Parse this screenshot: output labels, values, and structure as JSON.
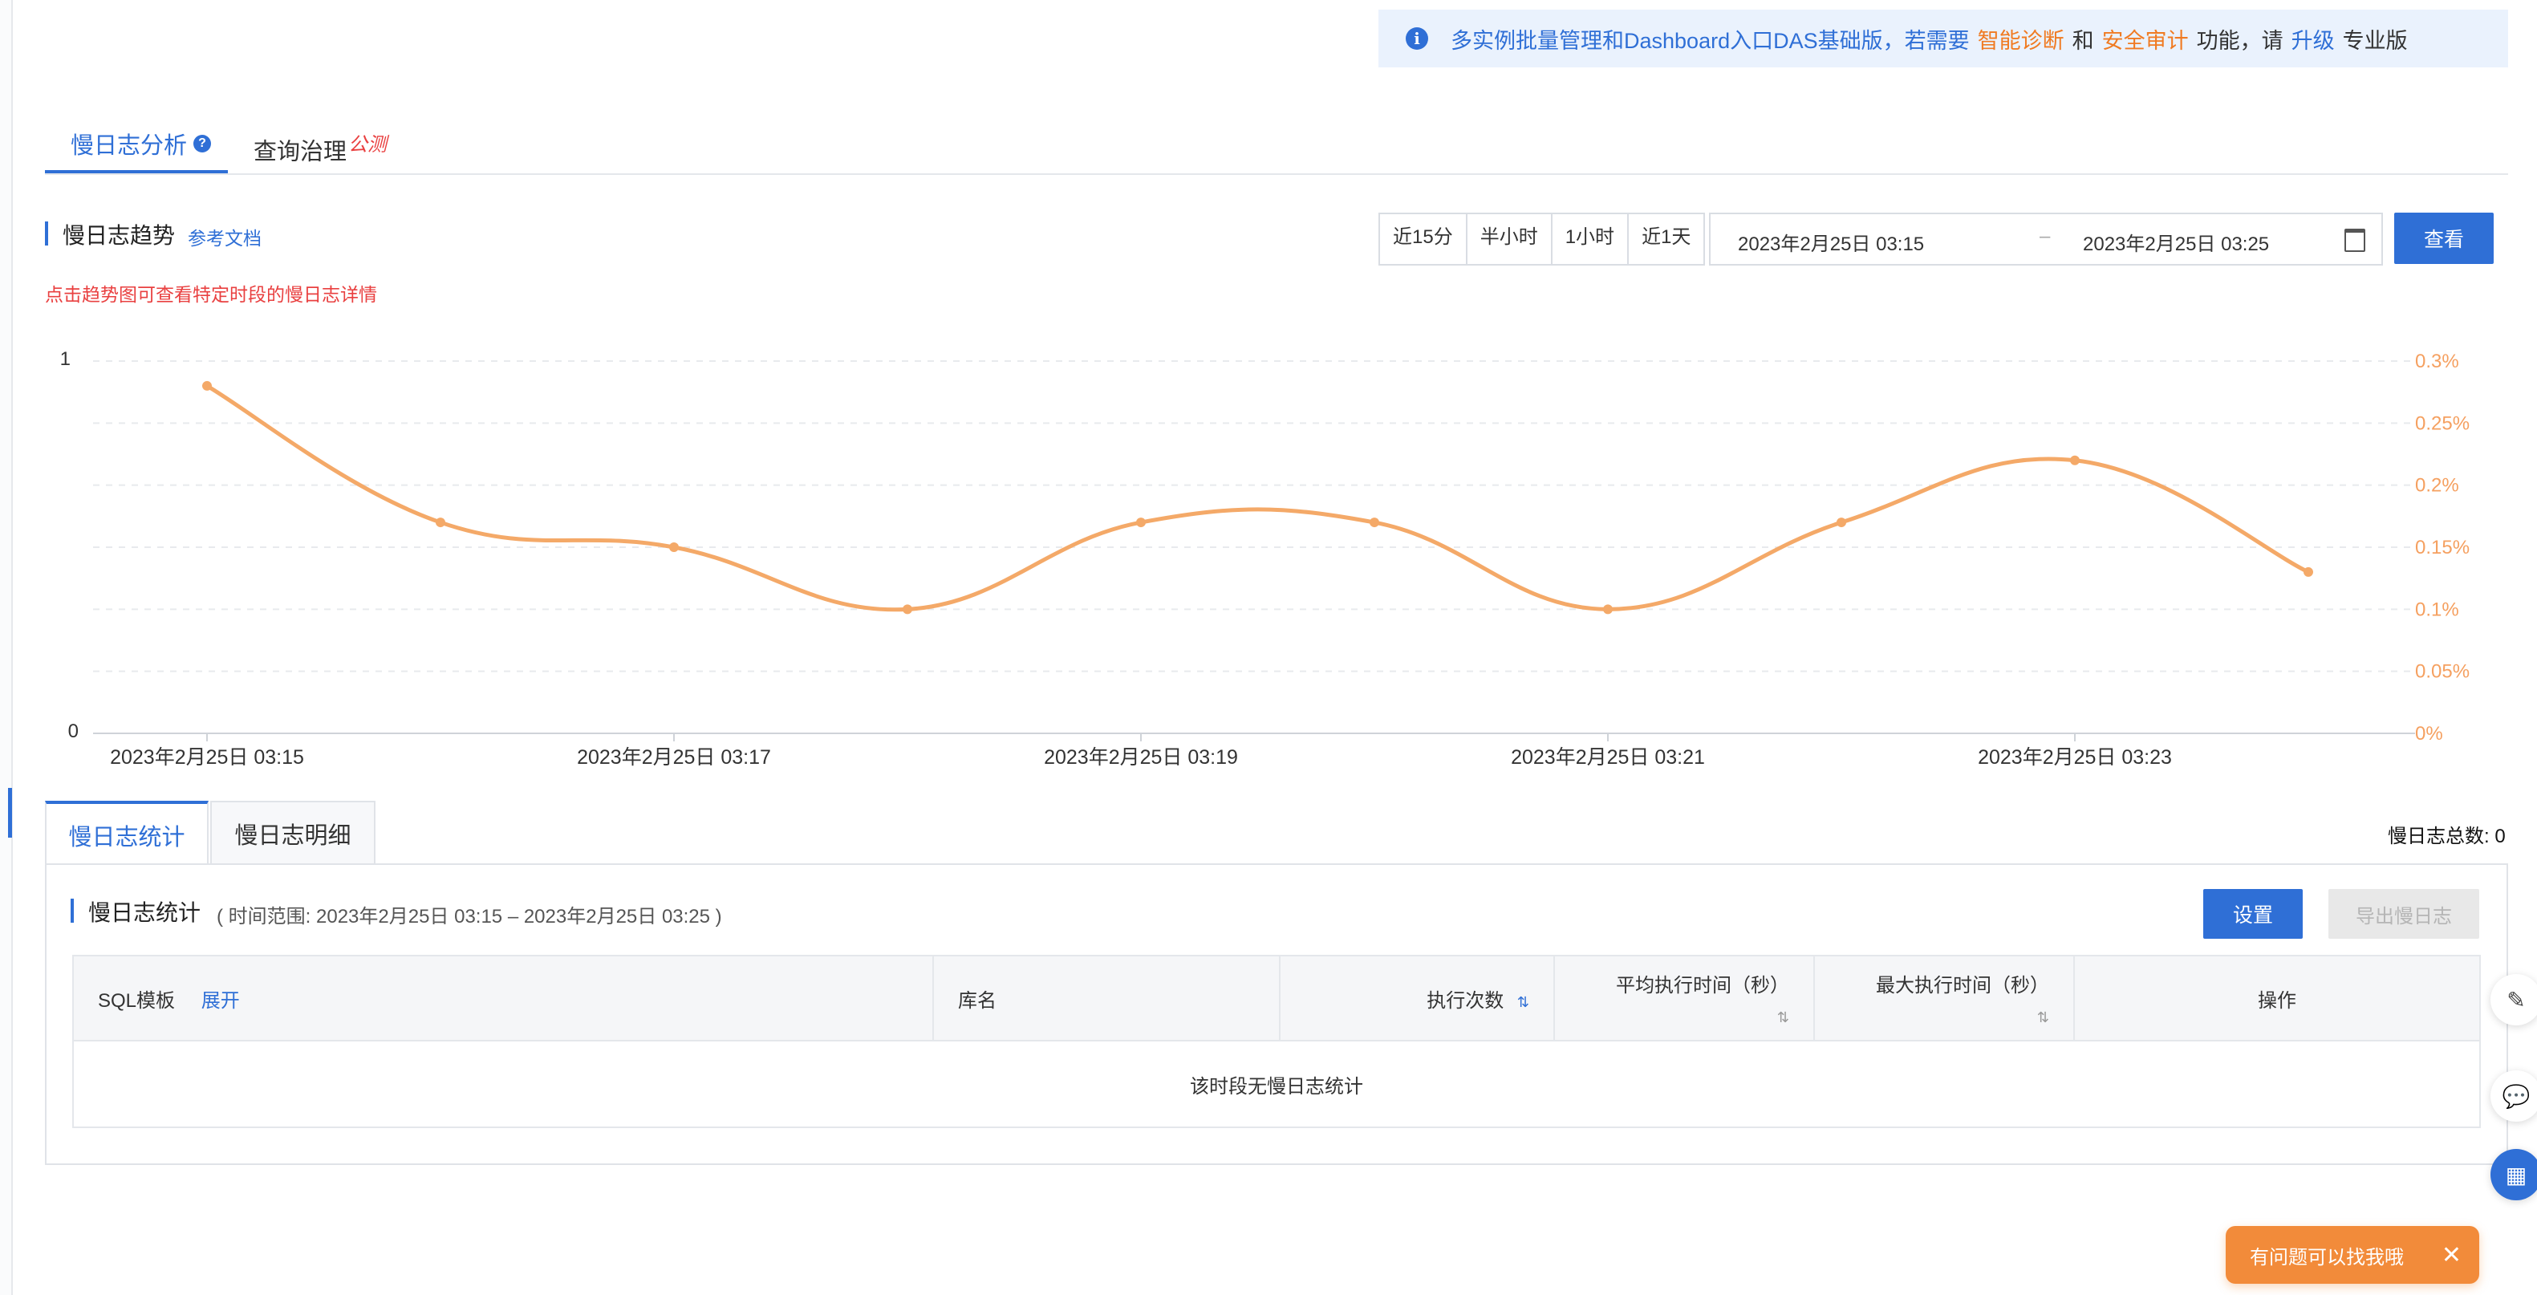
{
  "notice": {
    "prefix": "多实例批量管理和Dashboard入口DAS基础版，若需要",
    "link1": "智能诊断",
    "and": "和",
    "link2": "安全审计",
    "mid": "功能，请",
    "upgrade": "升级",
    "suffix": "专业版"
  },
  "tabs": {
    "slow_log_analysis": "慢日志分析",
    "query_governance": "查询治理",
    "public_beta": "公测"
  },
  "trend": {
    "title": "慢日志趋势",
    "doc_link": "参考文档",
    "hint": "点击趋势图可查看特定时段的慢日志详情"
  },
  "time_filter": {
    "quick": [
      "近15分",
      "半小时",
      "1小时",
      "近1天"
    ],
    "start": "2023年2月25日 03:15",
    "separator": "–",
    "end": "2023年2月25日 03:25",
    "query_button": "查看"
  },
  "chart_data": {
    "type": "line",
    "x_ticks": [
      "2023年2月25日 03:15",
      "2023年2月25日 03:17",
      "2023年2月25日 03:19",
      "2023年2月25日 03:21",
      "2023年2月25日 03:23"
    ],
    "x_minutes": [
      0,
      1,
      2,
      3,
      4,
      5,
      6,
      7,
      8,
      9
    ],
    "values": [
      0.28,
      0.17,
      0.15,
      0.1,
      0.17,
      0.17,
      0.1,
      0.17,
      0.22,
      0.13
    ],
    "left_axis_ticks": [
      "1",
      "0"
    ],
    "right_axis_ticks": [
      "0.3%",
      "0.25%",
      "0.2%",
      "0.15%",
      "0.1%",
      "0.05%",
      "0%"
    ],
    "ylim": [
      0,
      0.3
    ],
    "line_color": "#f4a968",
    "grid": "dashed-horizontal"
  },
  "lower_tabs": {
    "stats": "慢日志统计",
    "detail": "慢日志明细"
  },
  "total": "慢日志总数: 0",
  "stats": {
    "title": "慢日志统计",
    "range": "( 时间范围: 2023年2月25日 03:15 – 2023年2月25日 03:25 )",
    "settings_button": "设置",
    "export_button": "导出慢日志",
    "columns": {
      "sql": "SQL模板",
      "expand": "展开",
      "db": "库名",
      "exec_count": "执行次数",
      "avg_time": "平均执行时间（秒）",
      "max_time": "最大执行时间（秒）",
      "actions": "操作"
    },
    "empty": "该时段无慢日志统计"
  },
  "help": {
    "label": "有问题可以找我哦",
    "close": "✕"
  },
  "icons": {
    "info": "i",
    "sort": "⇅",
    "edit": "✎",
    "chat": "💬",
    "apps": "▦"
  },
  "colors": {
    "accent": "#2f6fd6",
    "orange": "#f07b22",
    "red": "#e94040",
    "line": "#f4a968"
  }
}
